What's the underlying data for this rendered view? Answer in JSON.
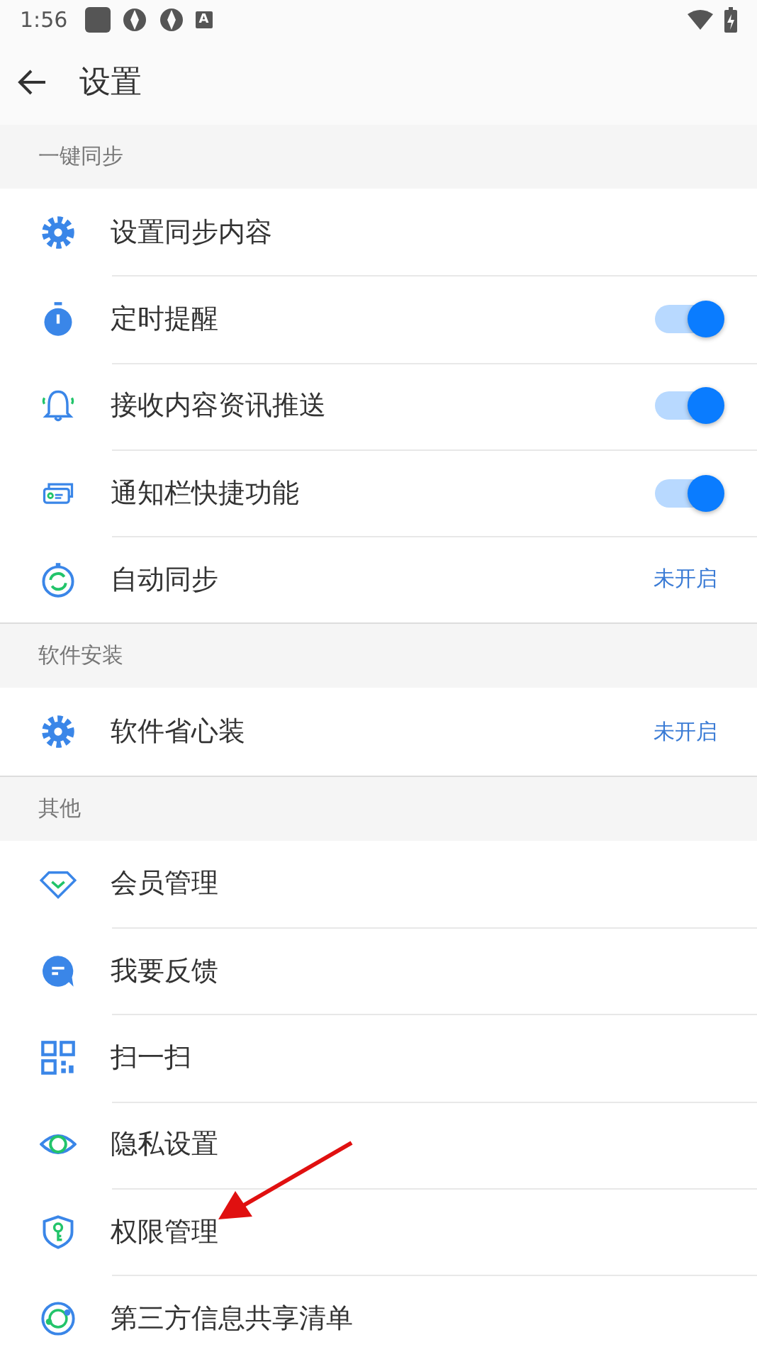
{
  "status_bar": {
    "time": "1:56",
    "notification_glyph": "A"
  },
  "toolbar": {
    "title": "设置"
  },
  "sections": [
    {
      "header": "一键同步",
      "items": [
        {
          "label": "设置同步内容",
          "kind": "plain"
        },
        {
          "label": "定时提醒",
          "kind": "toggle",
          "on": true
        },
        {
          "label": "接收内容资讯推送",
          "kind": "toggle",
          "on": true
        },
        {
          "label": "通知栏快捷功能",
          "kind": "toggle",
          "on": true
        },
        {
          "label": "自动同步",
          "kind": "value",
          "value": "未开启"
        }
      ]
    },
    {
      "header": "软件安装",
      "items": [
        {
          "label": "软件省心装",
          "kind": "value",
          "value": "未开启"
        }
      ]
    },
    {
      "header": "其他",
      "items": [
        {
          "label": "会员管理",
          "kind": "plain"
        },
        {
          "label": "我要反馈",
          "kind": "plain"
        },
        {
          "label": "扫一扫",
          "kind": "plain"
        },
        {
          "label": "隐私设置",
          "kind": "plain"
        },
        {
          "label": "权限管理",
          "kind": "plain"
        },
        {
          "label": "第三方信息共享清单",
          "kind": "plain"
        }
      ]
    }
  ]
}
